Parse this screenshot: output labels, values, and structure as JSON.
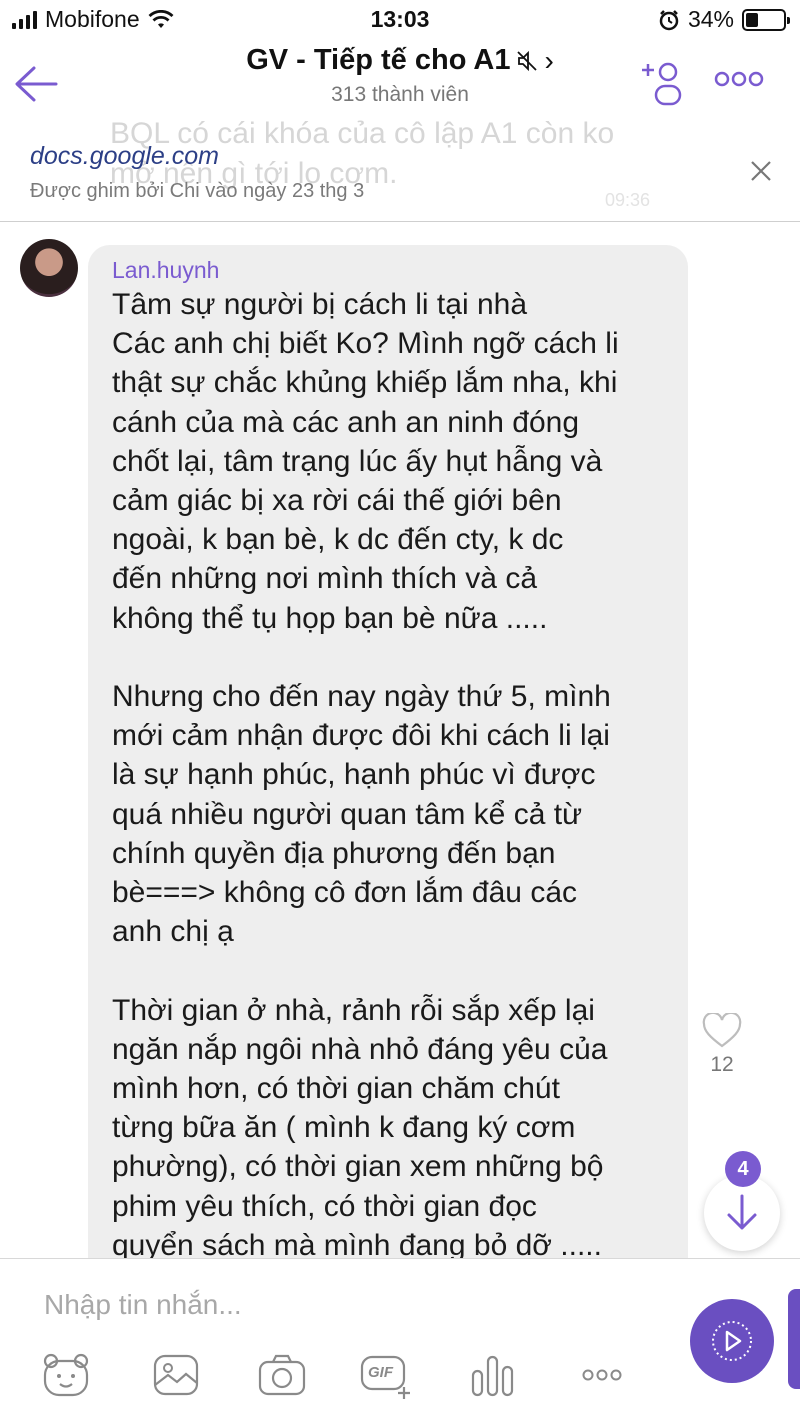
{
  "status_bar": {
    "carrier": "Mobifone",
    "time": "13:03",
    "battery": "34%",
    "battery_level": 0.34
  },
  "header": {
    "title": "GV - Tiếp tế cho A1",
    "title_arrow": "›",
    "members": "313 thành viên"
  },
  "pinned": {
    "ghost_text_1": "BQL có cái khóa của cô lập A1 còn ko",
    "ghost_text_2": "mở nên gì tới lo cơm.",
    "ghost_time": "09:36",
    "link": "docs.google.com",
    "pinned_by": "Được ghim bởi Chi vào ngày 23 thg 3"
  },
  "message": {
    "sender": "Lan.huynh",
    "text": "Tâm sự người bị cách li tại nhà\nCác anh chị biết Ko? Mình ngỡ cách li\nthật sự chắc khủng khiếp lắm nha, khi\ncánh của mà các anh an ninh đóng\nchốt lại, tâm trạng lúc ấy hụt hẫng và\ncảm giác bị xa rời cái thế giới bên\nngoài, k bạn bè, k dc đến cty, k dc\nđến những nơi mình thích và cả\nkhông thể tụ họp bạn bè nữa .....\n\nNhưng cho đến nay ngày thứ 5, mình\nmới cảm nhận được đôi khi cách li lại\nlà sự hạnh phúc, hạnh phúc vì được\nquá nhiều người quan tâm kể cả từ\nchính quyền địa phương đến bạn\nbè===> không cô đơn lắm đâu các\nanh chị ạ\n\nThời gian ở nhà, rảnh rỗi sắp xếp lại\nngăn nắp ngôi nhà nhỏ đáng yêu của\nmình hơn, có thời gian chăm chút\ntừng bữa ăn ( mình k đang ký cơm\nphường), có thời gian xem những bộ\nphim yêu thích, có thời gian đọc\nquyển sách mà mình đang bỏ dỡ .....",
    "likes": "12"
  },
  "scroll": {
    "unread_count": "4"
  },
  "composer": {
    "placeholder": "Nhập tin nhắn...",
    "gif_label": "GIF"
  },
  "icons": {
    "back": "arrow-left-icon",
    "add_member": "add-member-icon",
    "more": "more-dots-icon",
    "mute": "muted-speaker-icon",
    "close": "close-icon",
    "like": "heart-icon",
    "scroll_down": "arrow-down-icon",
    "send": "send-icon",
    "sticker": "sticker-bear-icon",
    "gallery": "image-icon",
    "camera": "camera-icon",
    "gif": "gif-icon",
    "poll": "poll-icon",
    "more_tools": "more-tools-icon"
  },
  "colors": {
    "accent": "#7a5bd0",
    "send_button": "#6a4fc1",
    "bubble": "#eeeeee",
    "link": "#2c3f86"
  }
}
